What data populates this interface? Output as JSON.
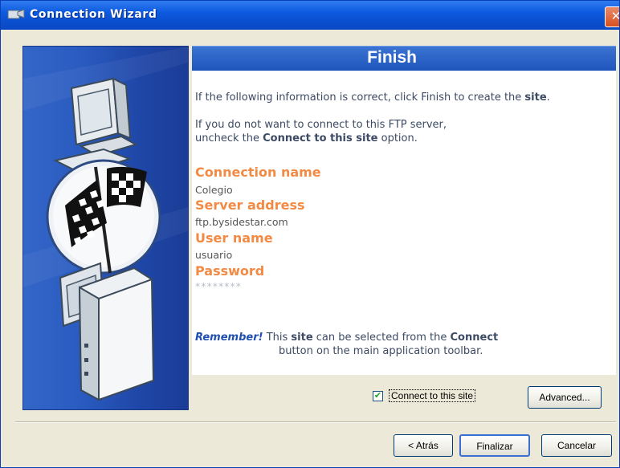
{
  "window": {
    "title": "Connection Wizard",
    "close_glyph": "✕"
  },
  "header": {
    "title": "Finish"
  },
  "intro": {
    "line1_pre": "If the following information is correct, click Finish to create the ",
    "line1_bold": "site",
    "line1_post": ".",
    "line2": "If you do not want to connect to this FTP server,",
    "line3_pre": "uncheck the ",
    "line3_bold": "Connect to this site",
    "line3_post": " option."
  },
  "fields": {
    "connection_name_label": "Connection name",
    "connection_name_value": "Colegio",
    "server_address_label": "Server address",
    "server_address_value": "ftp.bysidestar.com",
    "user_name_label": "User name",
    "user_name_value": "usuario",
    "password_label": "Password",
    "password_value": "********"
  },
  "remember": {
    "emph": "Remember!",
    "text1": " This ",
    "bold1": "site",
    "text2": " can be selected from the ",
    "bold2": "Connect",
    "line2": "button on the main application toolbar."
  },
  "options": {
    "connect_checkbox_label": "Connect to this site",
    "connect_checked": true,
    "check_glyph": "✔"
  },
  "buttons": {
    "advanced": "Advanced...",
    "back": "< Atrás",
    "finish": "Finalizar",
    "cancel": "Cancelar"
  },
  "colors": {
    "titlebar": "#0a4fd0",
    "banner": "#2a62c6",
    "label_orange": "#f28a44",
    "panel_blue": "#2a5bc0"
  },
  "icons": [
    "wizard-app-icon",
    "close-icon",
    "monitor-icon",
    "checkered-flag-icon",
    "computer-tower-icon",
    "checkbox-icon"
  ]
}
